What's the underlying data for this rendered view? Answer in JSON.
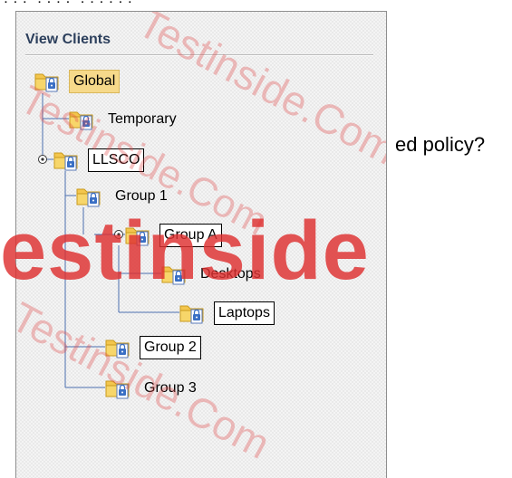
{
  "top_text": "??? ???? ??????",
  "side_text": "ed policy?",
  "panel": {
    "title": "View Clients"
  },
  "tree": [
    {
      "label": "Global",
      "style": "selected"
    },
    {
      "label": "Temporary",
      "style": "plain"
    },
    {
      "label": "LLSCO",
      "style": "boxed"
    },
    {
      "label": "Group 1",
      "style": "plain"
    },
    {
      "label": "Group A",
      "style": "boxed"
    },
    {
      "label": "Desktops",
      "style": "plain"
    },
    {
      "label": "Laptops",
      "style": "boxed"
    },
    {
      "label": "Group 2",
      "style": "boxed"
    },
    {
      "label": "Group 3",
      "style": "plain"
    }
  ],
  "watermark": {
    "main": "estinside",
    "diag": "Testinside.Com"
  },
  "colors": {
    "folder": "#f3c64d",
    "folder_dark": "#c99a1e",
    "doc_blue": "#3a6fc4",
    "tree_line": "#4b6fb0",
    "selected_bg": "#f6d98a",
    "watermark": "#de3030"
  }
}
